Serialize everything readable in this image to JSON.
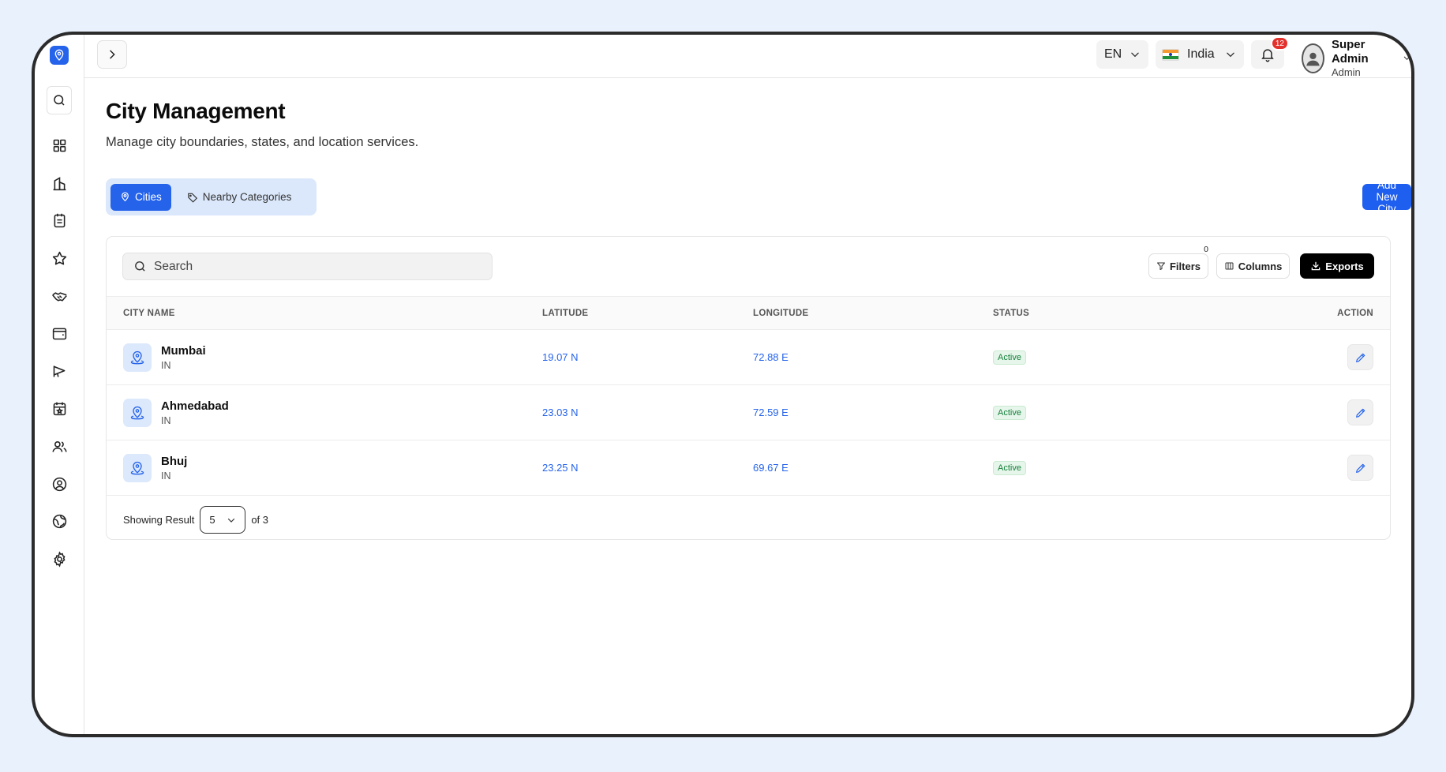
{
  "header": {
    "language": "EN",
    "country": "India",
    "notification_count": "12",
    "user_name": "Super Admin",
    "user_role": "Admin"
  },
  "page": {
    "title": "City Management",
    "subtitle": "Manage city boundaries, states, and location services."
  },
  "tabs": [
    {
      "label": "Cities",
      "active": true
    },
    {
      "label": "Nearby Categories",
      "active": false
    }
  ],
  "add_button": "Add New City",
  "toolbar": {
    "search_placeholder": "Search",
    "filters_label": "Filters",
    "filters_count": "0",
    "columns_label": "Columns",
    "exports_label": "Exports"
  },
  "table": {
    "headers": [
      "CITY NAME",
      "LATITUDE",
      "LONGITUDE",
      "STATUS",
      "ACTION"
    ],
    "rows": [
      {
        "name": "Mumbai",
        "code": "IN",
        "lat": "19.07 N",
        "lng": "72.88 E",
        "status": "Active"
      },
      {
        "name": "Ahmedabad",
        "code": "IN",
        "lat": "23.03 N",
        "lng": "72.59 E",
        "status": "Active"
      },
      {
        "name": "Bhuj",
        "code": "IN",
        "lat": "23.25 N",
        "lng": "69.67 E",
        "status": "Active"
      }
    ]
  },
  "pagination": {
    "prefix": "Showing Result",
    "page_size": "5",
    "suffix": "of 3"
  },
  "colors": {
    "accent": "#2563eb",
    "status_active": "#15803d",
    "badge": "#e3312d"
  }
}
